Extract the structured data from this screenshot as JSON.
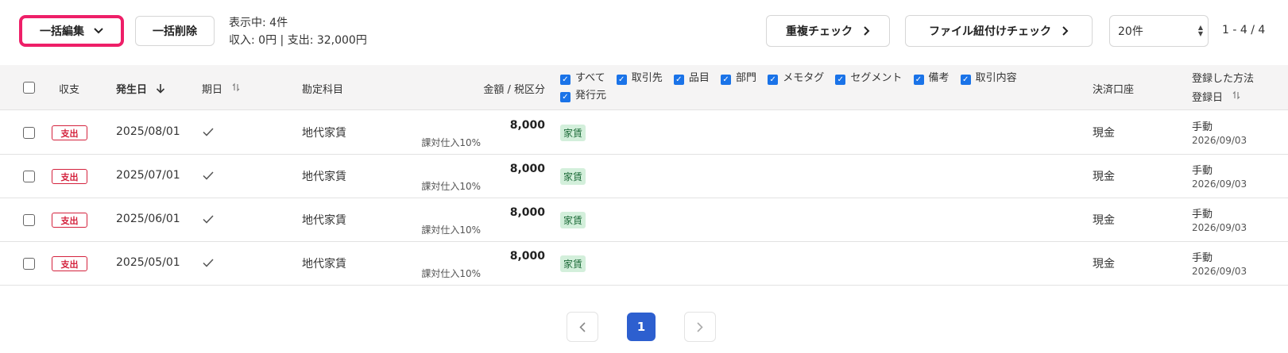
{
  "toolbar": {
    "bulk_edit_label": "一括編集",
    "bulk_delete_label": "一括削除",
    "summary_line1": "表示中: 4件",
    "summary_line2": "収入: 0円 | 支出: 32,000円",
    "duplicate_check_label": "重複チェック",
    "file_link_check_label": "ファイル紐付けチェック",
    "page_size_value": "20件",
    "range_label": "1 - 4 / 4"
  },
  "header": {
    "type": "収支",
    "date": "発生日",
    "due": "期日",
    "account": "勘定科目",
    "amount": "金額 / 税区分",
    "column_toggles": [
      "すべて",
      "取引先",
      "品目",
      "部門",
      "メモタグ",
      "セグメント",
      "備考",
      "取引内容",
      "発行元"
    ],
    "payment_account": "決済口座",
    "reg_method": "登録した方法",
    "reg_date": "登録日"
  },
  "rows": [
    {
      "type": "支出",
      "date": "2025/08/01",
      "account": "地代家賃",
      "amount": "8,000",
      "tax": "課対仕入10%",
      "tag": "家賃",
      "payment": "現金",
      "method": "手動",
      "reg_date": "2026/09/03"
    },
    {
      "type": "支出",
      "date": "2025/07/01",
      "account": "地代家賃",
      "amount": "8,000",
      "tax": "課対仕入10%",
      "tag": "家賃",
      "payment": "現金",
      "method": "手動",
      "reg_date": "2026/09/03"
    },
    {
      "type": "支出",
      "date": "2025/06/01",
      "account": "地代家賃",
      "amount": "8,000",
      "tax": "課対仕入10%",
      "tag": "家賃",
      "payment": "現金",
      "method": "手動",
      "reg_date": "2026/09/03"
    },
    {
      "type": "支出",
      "date": "2025/05/01",
      "account": "地代家賃",
      "amount": "8,000",
      "tax": "課対仕入10%",
      "tag": "家賃",
      "payment": "現金",
      "method": "手動",
      "reg_date": "2026/09/03"
    }
  ],
  "pagination": {
    "current_page": "1"
  },
  "colors": {
    "highlight": "#ee1f68",
    "expense_badge": "#d4223d",
    "tag_bg": "#d3efdb",
    "current_page_bg": "#2d5fcf",
    "checkbox_checked": "#1a73e8"
  }
}
